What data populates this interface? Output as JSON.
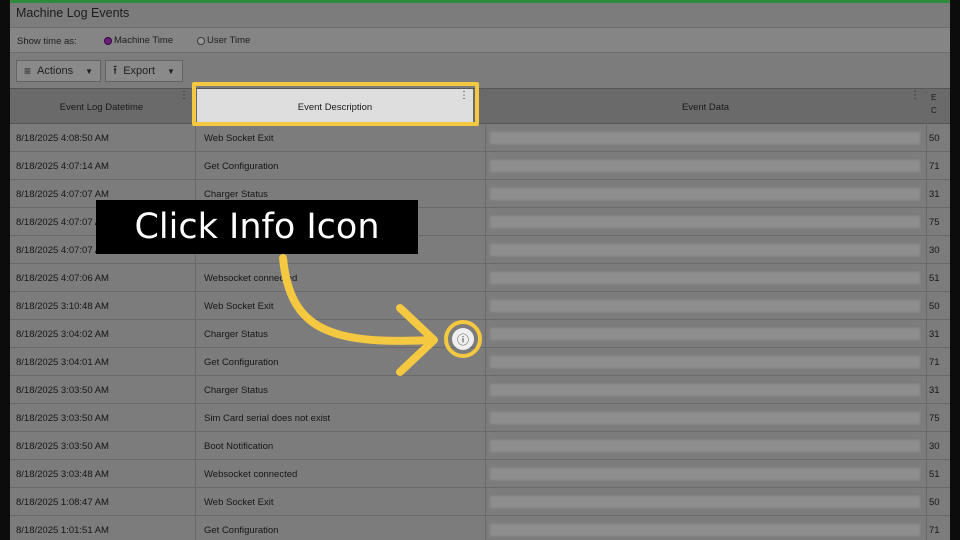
{
  "window": {
    "title": "Machine Log Events"
  },
  "options": {
    "show_time_label": "Show time as:",
    "machine_time": "Machine Time",
    "user_time": "User Time"
  },
  "toolbar": {
    "actions_label": "Actions",
    "export_label": "Export"
  },
  "columns": {
    "datetime": "Event Log Datetime",
    "description": "Event Description",
    "data": "Event Data",
    "extra_line1": "E",
    "extra_line2": "C"
  },
  "rows": [
    {
      "datetime": "8/18/2025 4:08:50 AM",
      "description": "Web Socket Exit",
      "code": "50"
    },
    {
      "datetime": "8/18/2025 4:07:14 AM",
      "description": "Get Configuration",
      "code": "71"
    },
    {
      "datetime": "8/18/2025 4:07:07 AM",
      "description": "Charger Status",
      "code": "31"
    },
    {
      "datetime": "8/18/2025 4:07:07 AM",
      "description": "",
      "code": "75"
    },
    {
      "datetime": "8/18/2025 4:07:07 AM",
      "description": "",
      "code": "30"
    },
    {
      "datetime": "8/18/2025 4:07:06 AM",
      "description": "Websocket connected",
      "code": "51"
    },
    {
      "datetime": "8/18/2025 3:10:48 AM",
      "description": "Web Socket Exit",
      "code": "50"
    },
    {
      "datetime": "8/18/2025 3:04:02 AM",
      "description": "Charger Status",
      "code": "31"
    },
    {
      "datetime": "8/18/2025 3:04:01 AM",
      "description": "Get Configuration",
      "code": "71"
    },
    {
      "datetime": "8/18/2025 3:03:50 AM",
      "description": "Charger Status",
      "code": "31"
    },
    {
      "datetime": "8/18/2025 3:03:50 AM",
      "description": "Sim Card serial does not exist",
      "code": "75"
    },
    {
      "datetime": "8/18/2025 3:03:50 AM",
      "description": "Boot Notification",
      "code": "30"
    },
    {
      "datetime": "8/18/2025 3:03:48 AM",
      "description": "Websocket connected",
      "code": "51"
    },
    {
      "datetime": "8/18/2025 1:08:47 AM",
      "description": "Web Socket Exit",
      "code": "50"
    },
    {
      "datetime": "8/18/2025 1:01:51 AM",
      "description": "Get Configuration",
      "code": "71"
    }
  ],
  "annotation": {
    "callout_text": "Click Info Icon",
    "info_glyph": "ⓘ",
    "highlight_color": "#f5c842"
  },
  "icons": {
    "actions": "hamburger-menu-icon",
    "export": "upload-icon"
  }
}
